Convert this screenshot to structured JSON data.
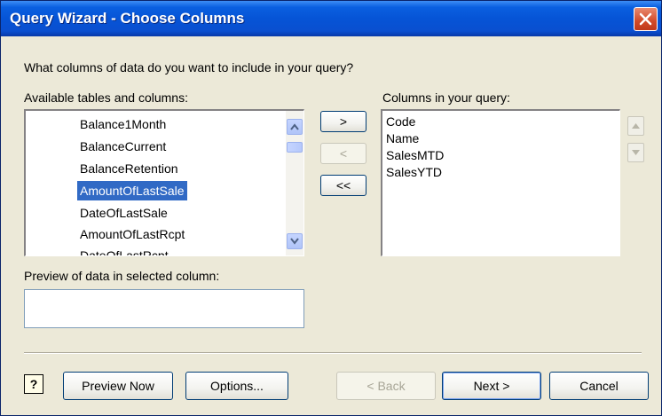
{
  "window": {
    "title": "Query Wizard - Choose Columns"
  },
  "prompt": "What columns of data do you want to include in your query?",
  "available": {
    "label": "Available tables and columns:",
    "items": [
      "Balance1Month",
      "BalanceCurrent",
      "BalanceRetention",
      "AmountOfLastSale",
      "DateOfLastSale",
      "AmountOfLastRcpt",
      "DateOfLastRcpt"
    ],
    "selected_index": 3
  },
  "transfer_buttons": {
    "add": ">",
    "remove": "<",
    "remove_all": "<<"
  },
  "query": {
    "label": "Columns in your query:",
    "items": [
      "Code",
      "Name",
      "SalesMTD",
      "SalesYTD"
    ]
  },
  "preview": {
    "label": "Preview of data in selected column:",
    "value": ""
  },
  "footer": {
    "help_symbol": "?",
    "preview_now": "Preview Now",
    "options": "Options...",
    "back": "< Back",
    "next": "Next >",
    "cancel": "Cancel"
  },
  "colors": {
    "titlebar": "#0654d6",
    "dialog_bg": "#ece9d8",
    "selection": "#316ac5",
    "close": "#d24a28"
  }
}
